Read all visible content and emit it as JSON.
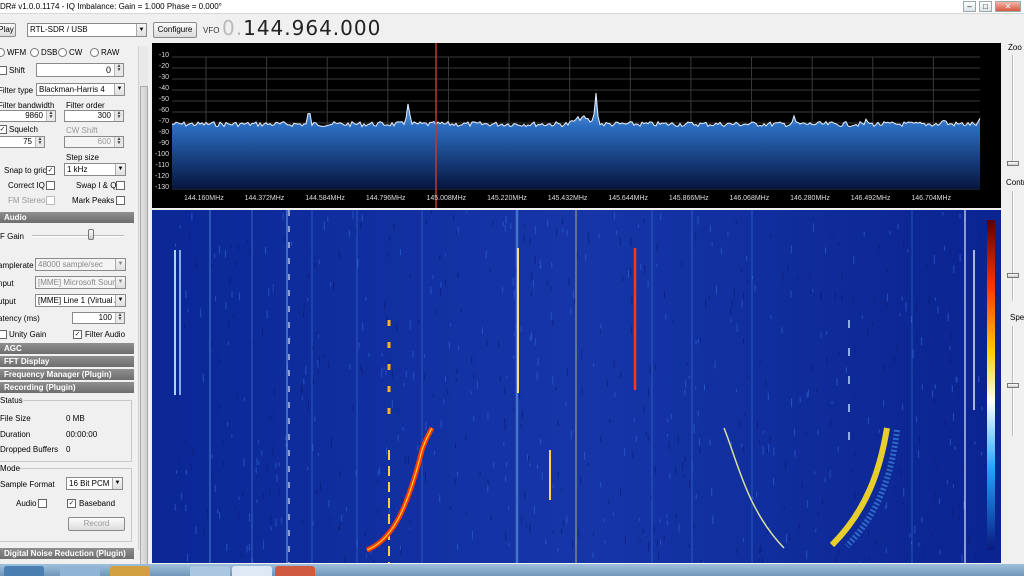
{
  "window": {
    "title": "DR# v1.0.0.1174 - IQ Imbalance: Gain = 1.000 Phase = 0.000°",
    "minimize": "–",
    "maximize": "□",
    "close": "✕"
  },
  "toolbar": {
    "play_label": "Play",
    "device_value": "RTL-SDR / USB",
    "configure_label": "Configure",
    "vfo_label": "VFO",
    "vfo_value_dim": "0.",
    "vfo_value": "144.964.000"
  },
  "radio": {
    "modes": [
      "WFM",
      "DSB",
      "CW",
      "RAW"
    ],
    "shift_label": "Shift",
    "shift_value": "0",
    "filter_type_label": "Filter type",
    "filter_type_value": "Blackman-Harris 4",
    "filter_bandwidth_label": "Filter bandwidth",
    "filter_bandwidth_value": "9860",
    "filter_order_label": "Filter order",
    "filter_order_value": "300",
    "squelch_label": "Squelch",
    "squelch_value": "75",
    "cw_shift_label": "CW Shift",
    "cw_shift_value": "600",
    "step_size_label": "Step size",
    "step_size_value": "1 kHz",
    "snap_label": "Snap to grid",
    "correct_iq_label": "Correct IQ",
    "swap_iq_label": "Swap I & Q",
    "fm_stereo_label": "FM Stereo",
    "mark_peaks_label": "Mark Peaks"
  },
  "audio": {
    "section_label": "Audio",
    "af_gain_label": "F Gain",
    "af_gain_level": 0.65,
    "samplerate_label": "amplerate",
    "samplerate_value": "48000 sample/sec",
    "input_label": "nput",
    "input_value": "[MME] Microsoft Sound",
    "output_label": "utput",
    "output_value": "[MME] Line 1 (Virtual A",
    "latency_label": "atency (ms)",
    "latency_value": "100",
    "unity_gain_label": "Unity Gain",
    "filter_audio_label": "Filter Audio"
  },
  "sections": {
    "agc": "AGC",
    "fft": "FFT Display",
    "freq_manager": "Frequency Manager (Plugin)",
    "recording": "Recording (Plugin)",
    "dnr": "Digital Noise Reduction (Plugin)"
  },
  "recording": {
    "status_group": "Status",
    "file_size_label": "File Size",
    "file_size_value": "0 MB",
    "duration_label": "Duration",
    "duration_value": "00:00:00",
    "dropped_label": "Dropped Buffers",
    "dropped_value": "0",
    "mode_group": "Mode",
    "sample_format_label": "Sample Format",
    "sample_format_value": "16 Bit PCM",
    "audio_label": "Audio",
    "baseband_label": "Baseband",
    "record_label": "Record"
  },
  "right_panel": {
    "zoom_label": "Zoo",
    "contrast_label": "Contr",
    "speed_label": "Spe"
  },
  "spectrum": {
    "y_ticks": [
      "-10",
      "-20",
      "-30",
      "-40",
      "-50",
      "-60",
      "-70",
      "-80",
      "-90",
      "-100",
      "-110",
      "-120",
      "-130"
    ],
    "x_ticks": [
      "144.160MHz",
      "144.372MHz",
      "144.584MHz",
      "144.796MHz",
      "145.008MHz",
      "145.220MHz",
      "145.432MHz",
      "145.644MHz",
      "145.866MHz",
      "146.068MHz",
      "146.280MHz",
      "146.492MHz",
      "146.704MHz"
    ]
  },
  "colors": {
    "spectrum_bg": "#000000",
    "spectrum_fill": "#2b6cc0",
    "vfo_line": "#c0392b",
    "waterfall_bg": "#0a2690",
    "section_bar": "#7a7a7a"
  }
}
